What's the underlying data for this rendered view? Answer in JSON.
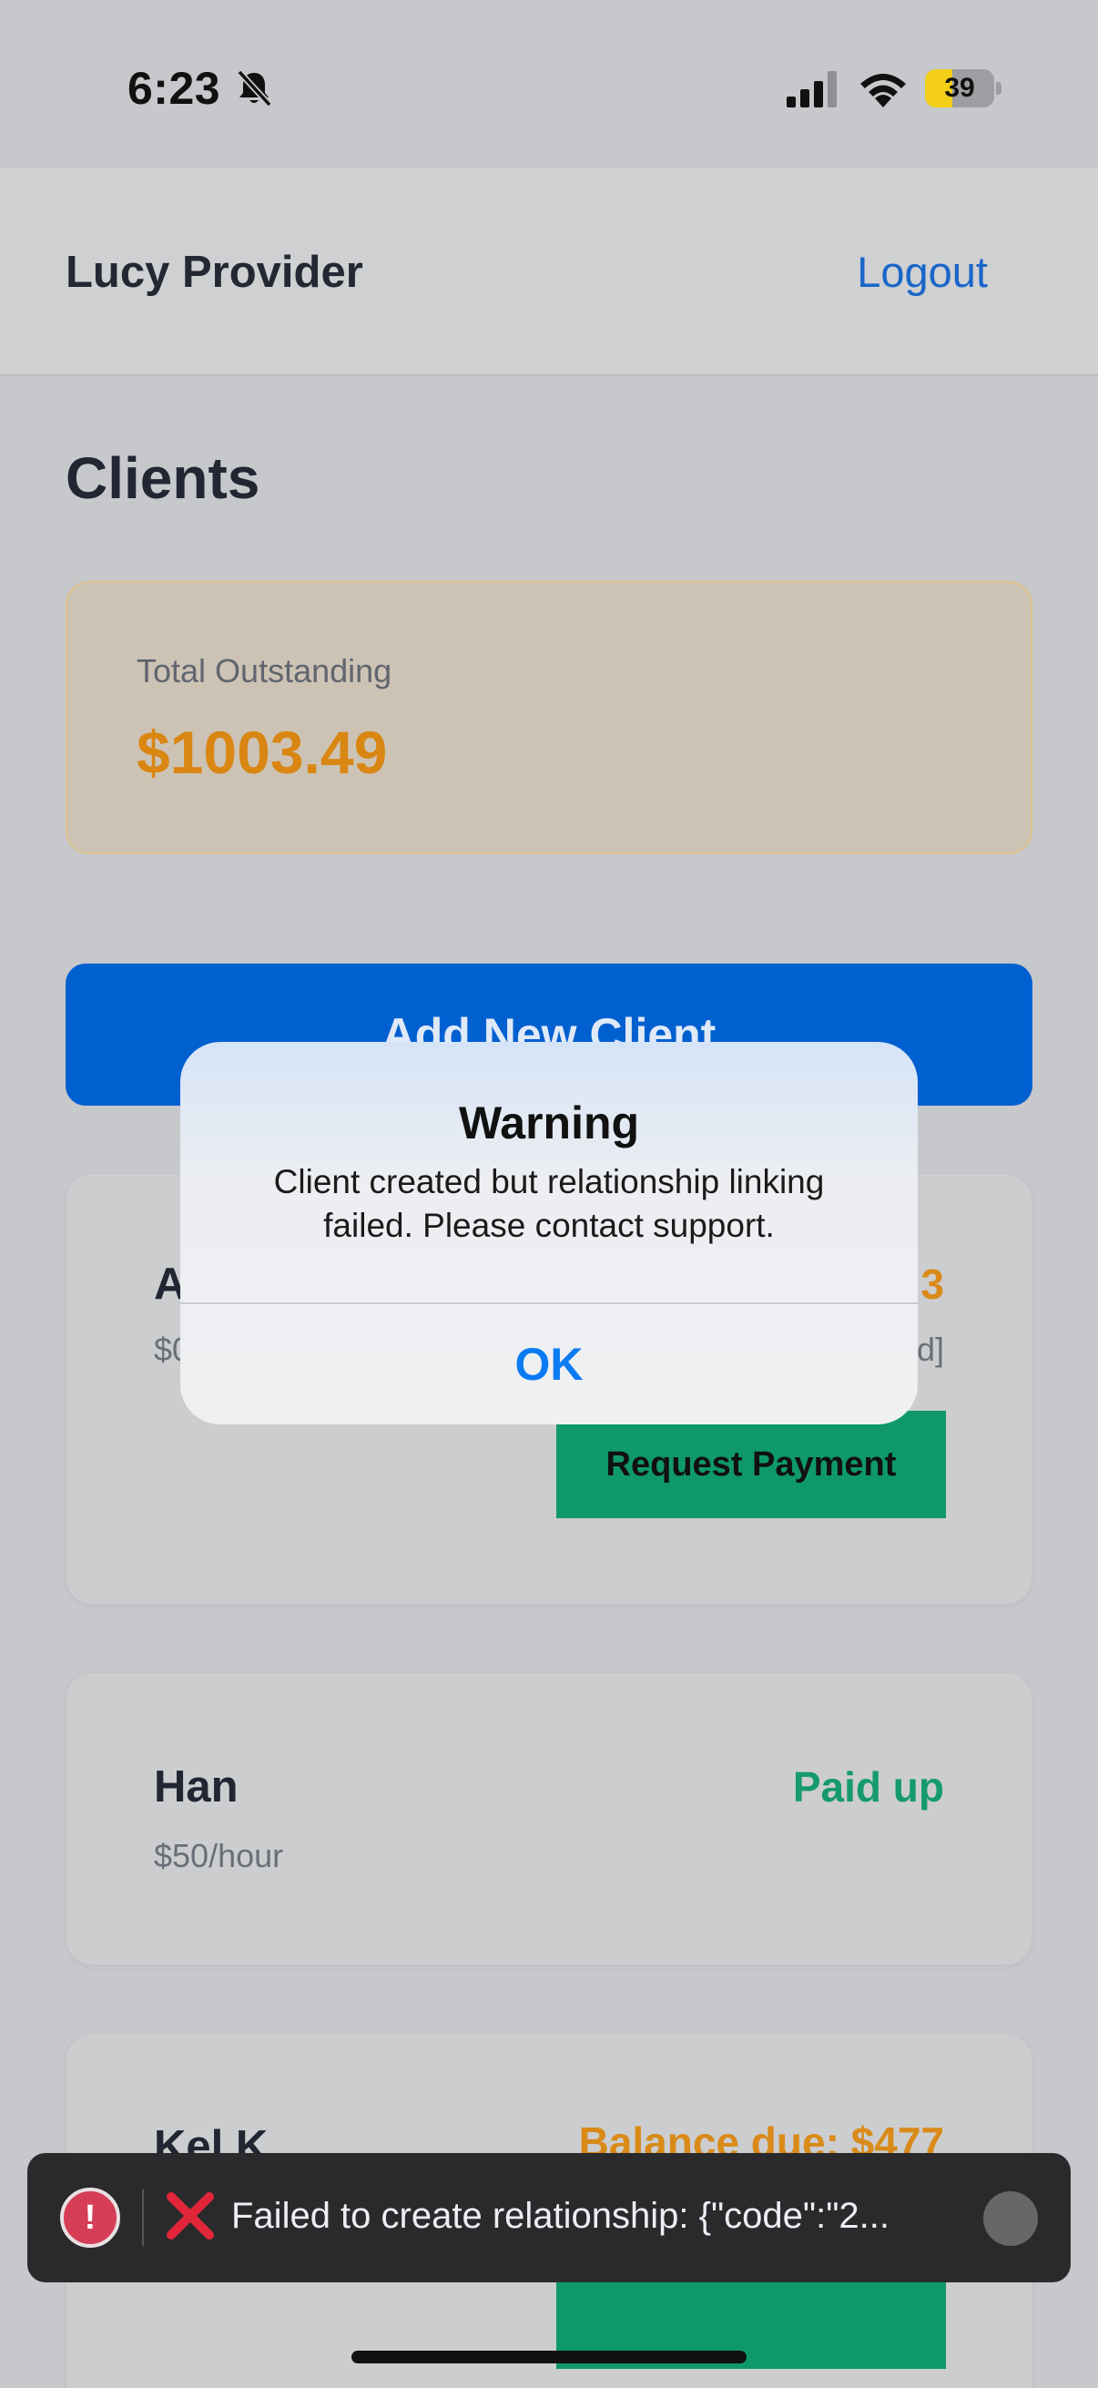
{
  "status_bar": {
    "time": "6:23",
    "battery_level": "39",
    "battery_fraction": 0.39,
    "icons": [
      "bell-slash-icon",
      "cellular-signal-icon",
      "wifi-icon",
      "battery-icon"
    ]
  },
  "header": {
    "provider_name": "Lucy Provider",
    "logout_label": "Logout"
  },
  "page": {
    "title": "Clients"
  },
  "summary": {
    "label": "Total Outstanding",
    "value": "$1003.49"
  },
  "add_client_label": "Add New Client",
  "clients": [
    {
      "name": "A",
      "rate": "$0",
      "status": "3",
      "status_extra": "d]",
      "action_label": "Request Payment"
    },
    {
      "name": "Han",
      "rate": "$50/hour",
      "status": "Paid up"
    },
    {
      "name": "Kel K",
      "status": "Balance due: $477"
    }
  ],
  "alert": {
    "title": "Warning",
    "message": "Client created but relationship linking failed. Please contact support.",
    "ok_label": "OK"
  },
  "toast": {
    "message": "Failed to create relationship: {\"code\":\"2...",
    "icons": [
      "error-icon",
      "x-mark-icon",
      "dismiss-icon"
    ]
  },
  "colors": {
    "accent_blue": "#0060d0",
    "link_blue": "#1a66c8",
    "warning_orange": "#d98612",
    "success_green": "#159a6c",
    "error_red": "#d63d57"
  }
}
